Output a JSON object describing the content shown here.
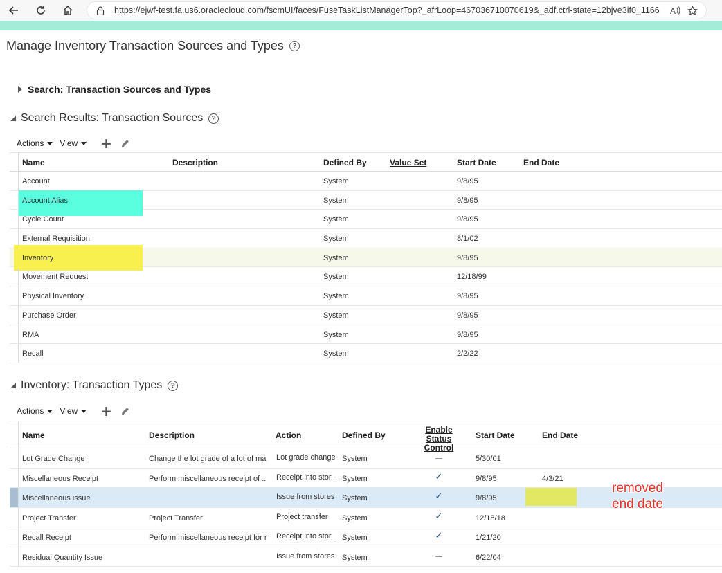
{
  "browser": {
    "url": "https://ejwf-test.fa.us6.oraclecloud.com/fscmUI/faces/FuseTaskListManagerTop?_afrLoop=467036710070619&_adf.ctrl-state=12bjve3if0_1166"
  },
  "page": {
    "title": "Manage Inventory Transaction Sources and Types"
  },
  "search": {
    "title": "Search: Transaction Sources and Types"
  },
  "sources": {
    "title": "Search Results: Transaction Sources",
    "toolbar": {
      "actions": "Actions",
      "view": "View"
    },
    "columns": {
      "name": "Name",
      "description": "Description",
      "defined_by": "Defined By",
      "value_set": "Value Set",
      "start_date": "Start Date",
      "end_date": "End Date"
    },
    "rows": [
      {
        "name": "Account",
        "description": "",
        "defined_by": "System",
        "value_set": "",
        "start_date": "9/8/95",
        "end_date": ""
      },
      {
        "name": "Account Alias",
        "description": "",
        "defined_by": "System",
        "value_set": "",
        "start_date": "9/8/95",
        "end_date": ""
      },
      {
        "name": "Cycle Count",
        "description": "",
        "defined_by": "System",
        "value_set": "",
        "start_date": "9/8/95",
        "end_date": ""
      },
      {
        "name": "External Requisition",
        "description": "",
        "defined_by": "System",
        "value_set": "",
        "start_date": "8/1/02",
        "end_date": ""
      },
      {
        "name": "Inventory",
        "description": "",
        "defined_by": "System",
        "value_set": "",
        "start_date": "9/8/95",
        "end_date": ""
      },
      {
        "name": "Movement Request",
        "description": "",
        "defined_by": "System",
        "value_set": "",
        "start_date": "12/18/99",
        "end_date": ""
      },
      {
        "name": "Physical Inventory",
        "description": "",
        "defined_by": "System",
        "value_set": "",
        "start_date": "9/8/95",
        "end_date": ""
      },
      {
        "name": "Purchase Order",
        "description": "",
        "defined_by": "System",
        "value_set": "",
        "start_date": "9/8/95",
        "end_date": ""
      },
      {
        "name": "RMA",
        "description": "",
        "defined_by": "System",
        "value_set": "",
        "start_date": "9/8/95",
        "end_date": ""
      },
      {
        "name": "Recall",
        "description": "",
        "defined_by": "System",
        "value_set": "",
        "start_date": "2/2/22",
        "end_date": ""
      }
    ]
  },
  "types": {
    "title": "Inventory: Transaction Types",
    "toolbar": {
      "actions": "Actions",
      "view": "View"
    },
    "columns": {
      "name": "Name",
      "description": "Description",
      "action": "Action",
      "defined_by": "Defined By",
      "enable_status_line1": "Enable Status",
      "enable_status_line2": "Control",
      "start_date": "Start Date",
      "end_date": "End Date"
    },
    "rows": [
      {
        "name": "Lot Grade Change",
        "description": "Change the lot grade of a lot of ma...",
        "action": "Lot grade change",
        "defined_by": "System",
        "status_control": false,
        "start_date": "5/30/01",
        "end_date": ""
      },
      {
        "name": "Miscellaneous Receipt",
        "description": "Perform miscellaneous receipt of ...",
        "action": "Receipt into stor...",
        "defined_by": "System",
        "status_control": true,
        "start_date": "9/8/95",
        "end_date": "4/3/21"
      },
      {
        "name": "Miscellaneous issue",
        "description": "",
        "action": "Issue from stores",
        "defined_by": "System",
        "status_control": true,
        "start_date": "9/8/95",
        "end_date": ""
      },
      {
        "name": "Project Transfer",
        "description": "Project Transfer",
        "action": "Project transfer",
        "defined_by": "System",
        "status_control": true,
        "start_date": "12/18/18",
        "end_date": ""
      },
      {
        "name": "Recall Receipt",
        "description": "Perform miscellaneous receipt for r...",
        "action": "Receipt into stor...",
        "defined_by": "System",
        "status_control": true,
        "start_date": "1/21/20",
        "end_date": ""
      },
      {
        "name": "Residual Quantity Issue",
        "description": "",
        "action": "Issue from stores",
        "defined_by": "System",
        "status_control": false,
        "start_date": "6/22/04",
        "end_date": ""
      }
    ]
  },
  "annotation": {
    "line1": "removed",
    "line2": "end date"
  },
  "colors": {
    "highlight_teal": "#59ffdf",
    "highlight_yellow": "#f8f04f",
    "selected_row": "#dbeaf7",
    "hover_row": "#f6f8e9",
    "annotation_red": "#e3342c"
  }
}
